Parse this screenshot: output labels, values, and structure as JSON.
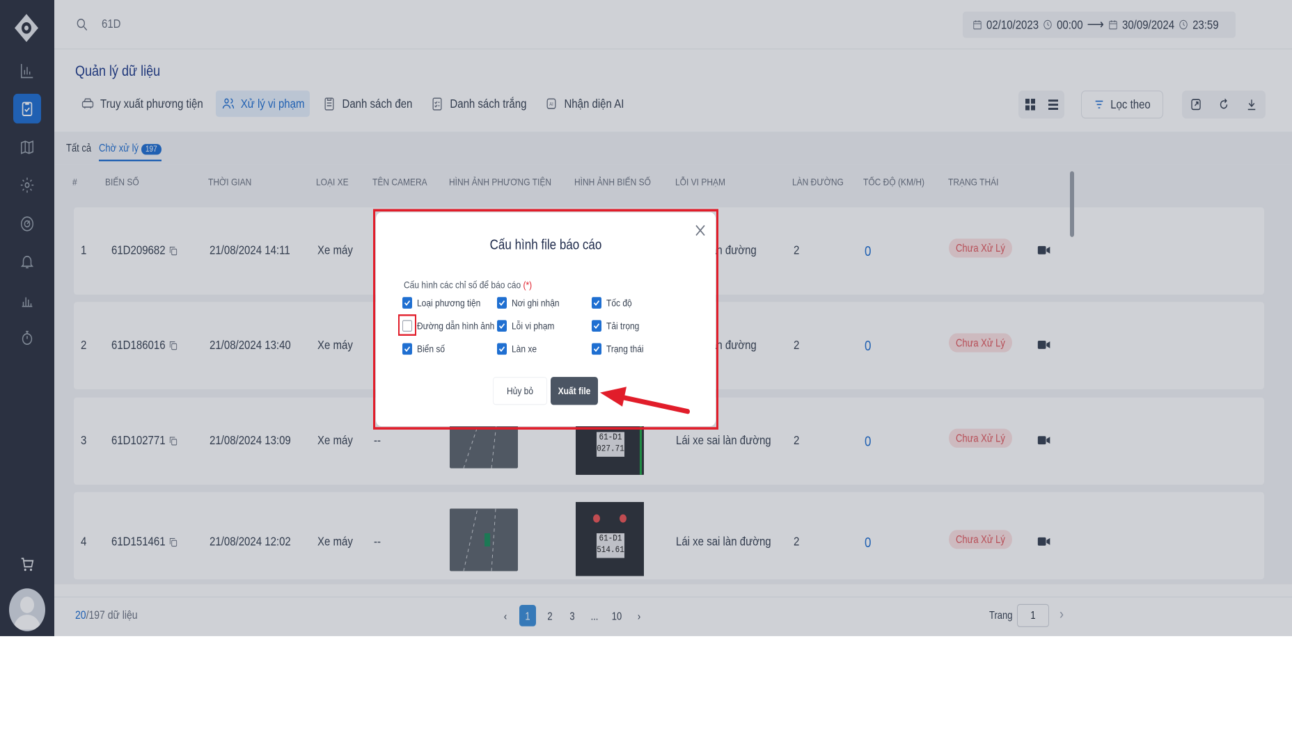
{
  "search": {
    "value": "61D"
  },
  "date_range": {
    "from_date": "02/10/2023",
    "from_time": "00:00",
    "arrow": "⟶",
    "to_date": "30/09/2024",
    "to_time": "23:59"
  },
  "page_title": "Quản lý dữ liệu",
  "nav": [
    {
      "label": "Truy xuất phương tiện",
      "icon": "car-icon"
    },
    {
      "label": "Xử lý vi phạm",
      "icon": "users-icon"
    },
    {
      "label": "Danh sách đen",
      "icon": "clipboard-icon"
    },
    {
      "label": "Danh sách trắng",
      "icon": "checklist-icon"
    },
    {
      "label": "Nhận diện AI",
      "icon": "ai-chip-icon"
    }
  ],
  "filter_label": "Lọc theo",
  "subtabs": {
    "all": "Tất cả",
    "pending": "Chờ xử lý",
    "pending_count": "197"
  },
  "table": {
    "headers": [
      "#",
      "BIẾN SỐ",
      "THỜI GIAN",
      "LOẠI XE",
      "TÊN CAMERA",
      "HÌNH ẢNH PHƯƠNG TIỆN",
      "HÌNH ẢNH BIẾN SỐ",
      "LỖI VI PHẠM",
      "LÀN ĐƯỜNG",
      "TỐC ĐỘ (KM/H)",
      "TRẠNG THÁI"
    ],
    "rows": [
      {
        "idx": "1",
        "plate": "61D209682",
        "time": "21/08/2024 14:11",
        "type": "Xe máy",
        "camera": "",
        "violation": "àn đường",
        "lane": "2",
        "speed": "0",
        "status": "Chưa Xử Lý"
      },
      {
        "idx": "2",
        "plate": "61D186016",
        "time": "21/08/2024 13:40",
        "type": "Xe máy",
        "camera": "",
        "violation": "àn đường",
        "lane": "2",
        "speed": "0",
        "status": "Chưa Xử Lý"
      },
      {
        "idx": "3",
        "plate": "61D102771",
        "time": "21/08/2024 13:09",
        "type": "Xe máy",
        "camera": "--",
        "violation": "Lái xe sai làn đường",
        "lane": "2",
        "speed": "0",
        "status": "Chưa Xử Lý",
        "plate_text": "61-D1 027.71"
      },
      {
        "idx": "4",
        "plate": "61D151461",
        "time": "21/08/2024 12:02",
        "type": "Xe máy",
        "camera": "--",
        "violation": "Lái xe sai làn đường",
        "lane": "2",
        "speed": "0",
        "status": "Chưa Xử Lý",
        "plate_text": "61-D1 514.61"
      }
    ]
  },
  "footer": {
    "shown": "20",
    "total": "/197",
    "suffix": " dữ liệu",
    "pages": [
      "1",
      "2",
      "3",
      "...",
      "10"
    ],
    "page_label": "Trang",
    "page_value": "1"
  },
  "modal": {
    "title": "Cấu hình file báo cáo",
    "subtitle": "Cấu hình các chỉ số để báo cáo",
    "required": "(*)",
    "options": [
      {
        "label": "Loại phương tiện",
        "checked": true
      },
      {
        "label": "Nơi ghi nhận",
        "checked": true
      },
      {
        "label": "Tốc độ",
        "checked": true
      },
      {
        "label": "Đường dẫn hình ảnh",
        "checked": false
      },
      {
        "label": "Lỗi vi phạm",
        "checked": true
      },
      {
        "label": "Tải trọng",
        "checked": true
      },
      {
        "label": "Biển số",
        "checked": true
      },
      {
        "label": "Làn xe",
        "checked": true
      },
      {
        "label": "Trạng thái",
        "checked": true
      }
    ],
    "cancel_label": "Hủy bỏ",
    "export_label": "Xuất file"
  },
  "colors": {
    "accent": "#1f6fd1",
    "highlight": "#e11d2a",
    "sidebar": "#2d3240"
  }
}
